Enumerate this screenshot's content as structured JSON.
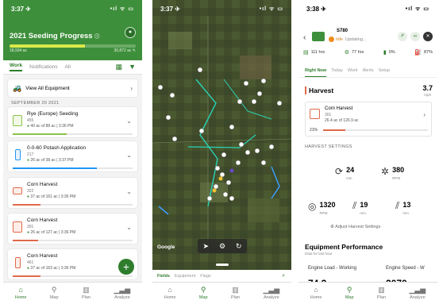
{
  "screen1": {
    "status": {
      "time": "3:37 ✈",
      "icons": "•ıl ᯤ ▭"
    },
    "title": "2021 Seeding Progress",
    "info_icon": "ⓘ",
    "progress": {
      "fraction": 0.6,
      "left": "18,934 ac",
      "right": "30,872 ac ✎"
    },
    "tabs": [
      "Work",
      "Notifications",
      "All"
    ],
    "view_all": "View All Equipment",
    "date_header": "SEPTEMBER 20 2021",
    "cards": [
      {
        "title": "Rye (Europe) Seeding",
        "sub": "455",
        "detail": "40 ac of 88 ac | 3:36 PM",
        "color": "#8bc34a",
        "progress": 0.45
      },
      {
        "title": "0-0-60 Potash Application",
        "sub": "217",
        "detail": "26 ac of 38 ac | 3:37 PM",
        "color": "#2196f3",
        "progress": 0.7
      },
      {
        "title": "Corn Harvest",
        "sub": "322",
        "detail": "37 ac of 161 ac | 3:36 PM",
        "color": "#e0694a",
        "progress": 0.23
      },
      {
        "title": "Corn Harvest",
        "sub": "301",
        "detail": "26 ac of 127 ac | 3:36 PM",
        "color": "#e0694a",
        "progress": 0.21
      },
      {
        "title": "Corn Harvest",
        "sub": "461",
        "detail": "37 ac of 163 ac | 3:36 PM",
        "color": "#e0694a",
        "progress": 0.23
      }
    ],
    "fab": "+",
    "nav": [
      "Home",
      "Map",
      "Plan",
      "Analyze"
    ]
  },
  "screen2": {
    "status": {
      "time": "3:37 ✈",
      "icons": "•ıl ᯤ ▭"
    },
    "google": "Google",
    "sheet_tabs": [
      "Fields",
      "Equipment",
      "Flags"
    ],
    "nav": [
      "Home",
      "Map",
      "Plan",
      "Analyze"
    ]
  },
  "screen3": {
    "status": {
      "time": "3:38 ✈",
      "icons": "•ıl ᯤ ▭"
    },
    "machine_id": "S780",
    "state": "Idle",
    "updating": "Updating...",
    "stats": [
      "111 hrs",
      "77 hrs",
      "0%",
      "87%"
    ],
    "tabs": [
      "Right Now",
      "Today",
      "Work",
      "Alerts",
      "Setup"
    ],
    "harvest_label": "Harvest",
    "speed": "3.7",
    "speed_unit": "mph",
    "op": {
      "title": "Corn Harvest",
      "sub": "301",
      "detail": "26.4 ac of 126.9 ac",
      "pct": "21%",
      "progress": 0.21
    },
    "settings_title": "HARVEST SETTINGS",
    "settings": [
      {
        "value": "24",
        "unit": "mm"
      },
      {
        "value": "380",
        "unit": "RPM"
      },
      {
        "value": "1320",
        "unit": "RPM"
      },
      {
        "value": "19",
        "unit": "mm"
      },
      {
        "value": "13",
        "unit": "mm"
      }
    ],
    "adjust": "Adjust Harvest Settings",
    "perf_title": "Equipment Performance",
    "perf_sub": "Data for last hour",
    "metrics": [
      "Engine Load - Working",
      "Engine Speed - W"
    ],
    "metric_values": [
      "74.2",
      "2070"
    ],
    "nav": [
      "Home",
      "Map",
      "Plan",
      "Analyze"
    ]
  }
}
